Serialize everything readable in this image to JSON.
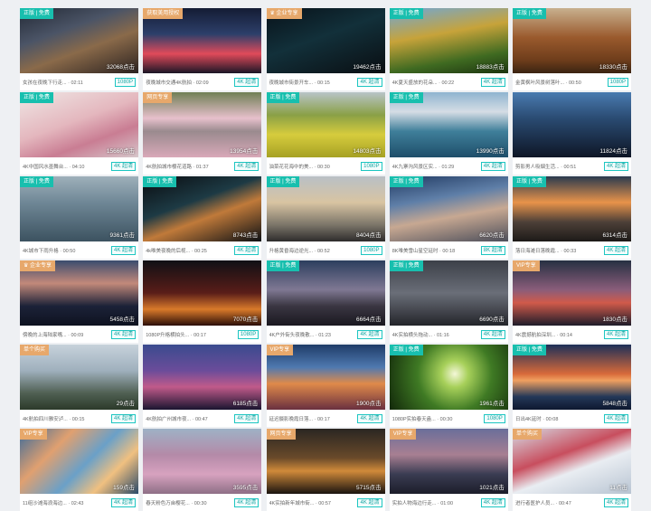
{
  "cards": [
    {
      "badge": "正版 | 免费",
      "badge_type": "free",
      "title": "女孩在夜晚下行走...",
      "duration": "02:11",
      "views": "32068点击",
      "res": "1080P",
      "bg": "linear-gradient(160deg,#232a36 0%,#4b5466 35%,#8a6a4a 60%,#2b2220 100%)"
    },
    {
      "badge": "获取美用授权",
      "badge_type": "exp",
      "title": "夜晚城市交通4K航拍",
      "duration": "02:09",
      "views": "",
      "res": "4K 超清",
      "bg": "linear-gradient(180deg,#141c34 0%,#2d3f6a 40%,#e04a5a 70%,#1b1626 100%)"
    },
    {
      "badge": "♛ 企业专享",
      "badge_type": "ent",
      "title": "夜晚城市街景开车...",
      "duration": "00:15",
      "views": "19462点击",
      "res": "4K 超清",
      "bg": "linear-gradient(160deg,#08121a 0%,#12303a 45%,#0a0e12 100%)"
    },
    {
      "badge": "正版 | 免费",
      "badge_type": "free",
      "title": "4K夏天盛放的花朵...",
      "duration": "00:22",
      "views": "18883点击",
      "res": "4K 超清",
      "bg": "linear-gradient(170deg,#6fa7d8 0%,#c7a33a 40%,#3f6a21 75%,#1d3510 100%)"
    },
    {
      "badge": "正版 | 免费",
      "badge_type": "free",
      "title": "金黄枫叶风景树落叶...",
      "duration": "00:50",
      "views": "18330点击",
      "res": "1080P",
      "bg": "linear-gradient(180deg,#c8b08e 0%,#9a5a2d 45%,#6e3d1b 80%,#3a2412 100%)"
    },
    {
      "badge": "正版 | 免费",
      "badge_type": "free",
      "title": "4K中国风水墨舞台...",
      "duration": "04:10",
      "views": "15660点击",
      "res": "4K 超清",
      "bg": "linear-gradient(160deg,#efe7e5 0%,#e4b7be 45%,#c97d93 70%,#d7c8cc 100%)"
    },
    {
      "badge": "网页专享",
      "badge_type": "exp",
      "title": "4K航拍城市樱花道路",
      "duration": "01:37",
      "views": "13954点击",
      "res": "4K 超清",
      "bg": "linear-gradient(180deg,#6f7f55 0%,#e7c0cc 40%,#9a8a8e 60%,#d9a9b9 100%)"
    },
    {
      "badge": "正版 | 免费",
      "badge_type": "free",
      "title": "油菜花花海中的美...",
      "duration": "00:30",
      "views": "14803点击",
      "res": "1080P",
      "bg": "linear-gradient(180deg,#b8c4c8 0%,#8aa046 35%,#d6cc3d 65%,#a6a124 100%)"
    },
    {
      "badge": "正版 | 免费",
      "badge_type": "free",
      "title": "4K九寨沟风景区实...",
      "duration": "01:29",
      "views": "13990点击",
      "res": "4K 超清",
      "bg": "linear-gradient(180deg,#8fb4cf 0%,#d5dde5 30%,#3f7f9a 60%,#1e4e6a 100%)"
    },
    {
      "badge": "",
      "badge_type": "",
      "title": "剪影男人吸烟生活...",
      "duration": "00:51",
      "views": "11824点击",
      "res": "4K 超清",
      "bg": "linear-gradient(180deg,#4a7bb0 0%,#2a4b72 40%,#0e1626 100%)"
    },
    {
      "badge": "正版 | 免费",
      "badge_type": "free",
      "title": "4K城市下雨升格",
      "duration": "00:50",
      "views": "9361点击",
      "res": "4K 超清",
      "bg": "linear-gradient(180deg,#9eb0ba 0%,#6f8796 40%,#3c5260 100%)"
    },
    {
      "badge": "正版 | 免费",
      "badge_type": "free",
      "title": "4k唯美夜晚的后视...",
      "duration": "00:25",
      "views": "8743点击",
      "res": "4K 超清",
      "bg": "linear-gradient(160deg,#0a0c10 0%,#1d3a44 40%,#c07a3a 60%,#0d1014 100%)"
    },
    {
      "badge": "正版 | 免费",
      "badge_type": "free",
      "title": "升格黄昏海边逆光...",
      "duration": "00:52",
      "views": "8404点击",
      "res": "1080P",
      "bg": "linear-gradient(180deg,#b9c0c6 0%,#d8c4a2 40%,#7a7468 75%,#2e2c2c 100%)"
    },
    {
      "badge": "正版 | 免费",
      "badge_type": "free",
      "title": "8K唯美雪山星空延时",
      "duration": "00:18",
      "views": "6620点击",
      "res": "8K 超清",
      "bg": "linear-gradient(170deg,#223b63 0%,#5f7fa8 35%,#c7a892 60%,#4d4f5b 100%)"
    },
    {
      "badge": "正版 | 免费",
      "badge_type": "free",
      "title": "落日海滩日落晚霞...",
      "duration": "00:33",
      "views": "6314点击",
      "res": "4K 超清",
      "bg": "linear-gradient(180deg,#2a3a4e 0%,#e8934a 40%,#4d4038 70%,#1d1a18 100%)"
    },
    {
      "badge": "♛ 企业专享",
      "badge_type": "ent",
      "title": "傍晚的上海陆家嘴...",
      "duration": "00:09",
      "views": "5458点击",
      "res": "4K 超清",
      "bg": "linear-gradient(180deg,#3a4c6e 0%,#c2897a 35%,#1c2238 70%,#0e1220 100%)"
    },
    {
      "badge": "",
      "badge_type": "",
      "title": "1080P升格横拍头...",
      "duration": "00:17",
      "views": "7070点击",
      "res": "1080P",
      "bg": "linear-gradient(180deg,#101015 0%,#5a1d18 50%,#d97a2a 75%,#2b0e08 100%)"
    },
    {
      "badge": "正版 | 免费",
      "badge_type": "free",
      "title": "4K户外街头夜晚散...",
      "duration": "01:23",
      "views": "6664点击",
      "res": "4K 超清",
      "bg": "linear-gradient(180deg,#2c3e5e 0%,#7f7893 45%,#3a3642 70%,#1a1820 100%)"
    },
    {
      "badge": "正版 | 免费",
      "badge_type": "free",
      "title": "4K实拍横头拖动...",
      "duration": "01:16",
      "views": "6690点击",
      "res": "4K 超清",
      "bg": "linear-gradient(180deg,#3c4048 0%,#6a6e78 50%,#23252a 100%)"
    },
    {
      "badge": "VIP专享",
      "badge_type": "vip",
      "title": "4K震撼航拍深圳...",
      "duration": "00:14",
      "views": "1830点击",
      "res": "4K 超清",
      "bg": "linear-gradient(180deg,#263042 0%,#8a5d7a 45%,#d05a4a 65%,#1e1c2a 100%)"
    },
    {
      "badge": "单个购买",
      "badge_type": "single",
      "title": "4K航拍四川雅安泸...",
      "duration": "00:15",
      "views": "29点击",
      "res": "4K 超清",
      "bg": "linear-gradient(180deg,#c7d2db 0%,#9fb0bd 40%,#4f5f52 75%,#2c3a2a 100%)"
    },
    {
      "badge": "",
      "badge_type": "",
      "title": "4K航拍广州城市夜...",
      "duration": "00:47",
      "views": "6185点击",
      "res": "4K 超清",
      "bg": "linear-gradient(180deg,#3a4b8e 0%,#6b4c9a 40%,#c05a8a 65%,#1a1530 100%)"
    },
    {
      "badge": "VIP专享",
      "badge_type": "vip",
      "title": "延迟摄影晚霞日落...",
      "duration": "00:17",
      "views": "1900点击",
      "res": "4K 超清",
      "bg": "linear-gradient(180deg,#1f3c68 0%,#4f79b0 35%,#e08a4a 60%,#6a3040 100%)"
    },
    {
      "badge": "正版 | 免费",
      "badge_type": "free",
      "title": "1080P实拍春天盎...",
      "duration": "00:30",
      "views": "1961点击",
      "res": "1080P",
      "bg": "radial-gradient(circle at 55% 45%,#f4f7d8 0%,#a7d05a 18%,#3f7a24 50%,#12280a 100%)"
    },
    {
      "badge": "正版 | 免费",
      "badge_type": "free",
      "title": "日出4K延时",
      "duration": "00:08",
      "views": "5848点击",
      "res": "4K 超清",
      "bg": "linear-gradient(180deg,#1c2f58 0%,#d86a3a 45%,#f0a060 55%,#243858 80%,#0e1830 100%)"
    },
    {
      "badge": "VIP专享",
      "badge_type": "vip",
      "title": "11组沙滩海浪海边...",
      "duration": "02:43",
      "views": "159点击",
      "res": "4K 超清",
      "bg": "linear-gradient(135deg,#3a6a9a 0%,#e0a070 30%,#6aa0c8 55%,#f0c080 75%,#2a4a6a 100%)"
    },
    {
      "badge": "",
      "badge_type": "",
      "title": "春天粉色万亩樱花...",
      "duration": "00:30",
      "views": "3595点击",
      "res": "4K 超清",
      "bg": "linear-gradient(180deg,#9eb2c6 0%,#b48aa8 40%,#d7a2bf 70%,#8e6f86 100%)"
    },
    {
      "badge": "网页专享",
      "badge_type": "exp",
      "title": "4K实拍新年城市街...",
      "duration": "00:57",
      "views": "5715点击",
      "res": "4K 超清",
      "bg": "linear-gradient(180deg,#2a2622 0%,#6a4a2a 45%,#d08a3a 65%,#1a1410 100%)"
    },
    {
      "badge": "VIP专享",
      "badge_type": "vip",
      "title": "实拍人物海边行走...",
      "duration": "01:00",
      "views": "1021点击",
      "res": "4K 超清",
      "bg": "linear-gradient(180deg,#6a6e9a 0%,#a87f92 40%,#3a3c52 70%,#1c1d2a 100%)"
    },
    {
      "badge": "单个购买",
      "badge_type": "single",
      "title": "进行者医护人员...",
      "duration": "00:47",
      "views": "11点击",
      "res": "4K 超清",
      "bg": "linear-gradient(160deg,#d6dde6 0%,#c84e5e 40%,#e9edf2 60%,#b8c4d2 100%)"
    }
  ]
}
